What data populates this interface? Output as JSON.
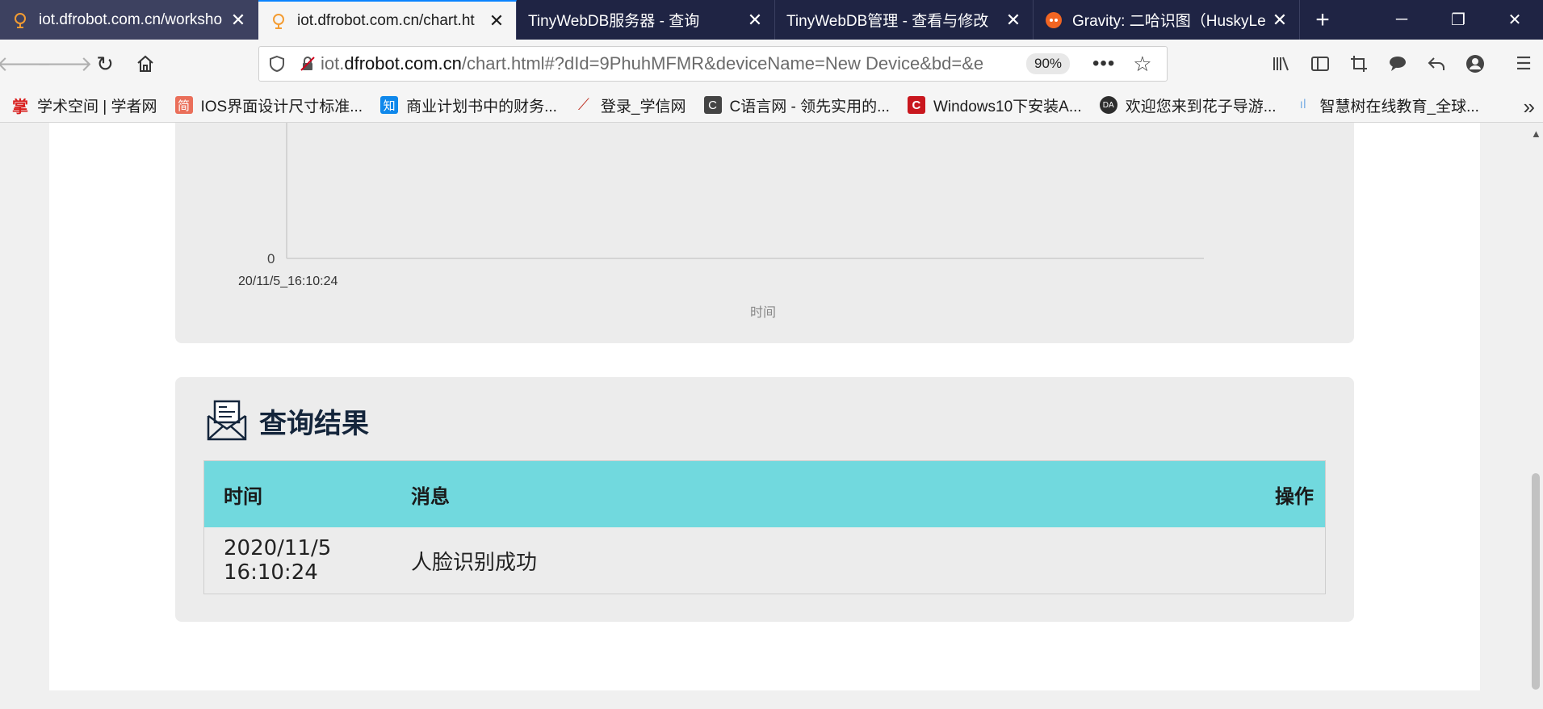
{
  "tabs": [
    {
      "title": "iot.dfrobot.com.cn/worksho",
      "favicon": "cloud-icon"
    },
    {
      "title": "iot.dfrobot.com.cn/chart.ht",
      "favicon": "cloud-icon"
    },
    {
      "title": "TinyWebDB服务器 - 查询",
      "favicon": ""
    },
    {
      "title": "TinyWebDB管理 - 查看与修改",
      "favicon": ""
    },
    {
      "title": "Gravity: 二哈识图（HuskyLe",
      "favicon": "robot-icon"
    }
  ],
  "new_tab_label": "+",
  "address_bar": {
    "url_prefix": "iot.",
    "url_domain": "dfrobot.com.cn",
    "url_path": "/chart.html#?dId=9PhuhMFMR&deviceName=New Device&bd=&e",
    "zoom": "90%"
  },
  "bookmarks": [
    {
      "label": "学术空间 | 学者网",
      "icon": "scholar-icon",
      "badge": "掌",
      "color": "#d9201f"
    },
    {
      "label": "IOS界面设计尺寸标准...",
      "icon": "jian-icon",
      "badge": "简",
      "color": "#ea6f5a"
    },
    {
      "label": "商业计划书中的财务...",
      "icon": "zhihu-icon",
      "badge": "知",
      "color": "#0f88eb"
    },
    {
      "label": "登录_学信网",
      "icon": "chsi-icon",
      "badge": "⟋",
      "color": "#c0392b"
    },
    {
      "label": "C语言网 - 领先实用的...",
      "icon": "dotcpp-icon",
      "badge": "C",
      "color": "#444444"
    },
    {
      "label": "Windows10下安装A...",
      "icon": "csdn-icon",
      "badge": "C",
      "color": "#c9171e"
    },
    {
      "label": "欢迎您来到花子导游...",
      "icon": "da-icon",
      "badge": "DA",
      "color": "#2d2d2d"
    },
    {
      "label": "智慧树在线教育_全球...",
      "icon": "zhihuishu-icon",
      "badge": "ıl",
      "color": "#7fb2e5"
    }
  ],
  "chart": {
    "y_zero_label": "0",
    "x_tick_label": "20/11/5_16:10:24",
    "x_axis_label": "时间"
  },
  "chart_data": {
    "type": "line",
    "x": [
      "20/11/5_16:10:24"
    ],
    "y_tick_visible": "0",
    "xlabel": "时间",
    "ylabel": ""
  },
  "results": {
    "title": "查询结果",
    "columns": {
      "time": "时间",
      "message": "消息",
      "action": "操作"
    },
    "rows": [
      {
        "time": "2020/11/5 16:10:24",
        "message": "人脸识别成功",
        "action": ""
      }
    ]
  },
  "colors": {
    "tabstrip": "#1f2444",
    "table_header": "#71d9de",
    "card_bg": "#ececec",
    "title_color": "#14253b"
  }
}
